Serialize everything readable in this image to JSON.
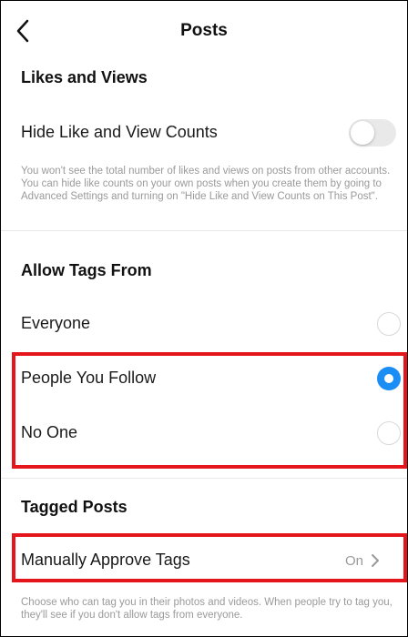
{
  "header": {
    "title": "Posts"
  },
  "likes_views": {
    "heading": "Likes and Views",
    "toggle_label": "Hide Like and View Counts",
    "toggle_on": false,
    "caption": "You won't see the total number of likes and views on posts from other accounts. You can hide like counts on your own posts when you create them by going to Advanced Settings and turning on \"Hide Like and View Counts on This Post\"."
  },
  "allow_tags": {
    "heading": "Allow Tags From",
    "options": [
      {
        "label": "Everyone",
        "selected": false
      },
      {
        "label": "People You Follow",
        "selected": true
      },
      {
        "label": "No One",
        "selected": false
      }
    ]
  },
  "tagged_posts": {
    "heading": "Tagged Posts",
    "manual_label": "Manually Approve Tags",
    "manual_value": "On",
    "caption": "Choose who can tag you in their photos and videos. When people try to tag you, they'll see if you don't allow tags from everyone."
  },
  "colors": {
    "accent_blue": "#1a8ef5",
    "highlight_red": "#e4161b",
    "caption_gray": "#9a9a9a"
  },
  "icons": {
    "back": "chevron-left-icon",
    "forward": "chevron-right-icon"
  }
}
